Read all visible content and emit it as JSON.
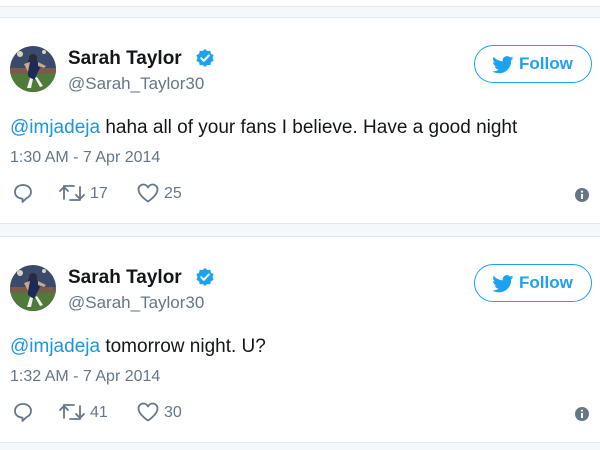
{
  "colors": {
    "accent": "#1da1f2",
    "mention": "#1b95e0",
    "text": "#14171a",
    "muted": "#657786",
    "verified": "#1da1f2"
  },
  "tweets": [
    {
      "user": {
        "name": "Sarah Taylor",
        "handle": "@Sarah_Taylor30",
        "verified": true,
        "avatar_icon": "avatar-photo"
      },
      "follow_label": "Follow",
      "mention": "@imjadeja",
      "text": " haha all of your fans I believe. Have a good night",
      "timestamp": "1:30 AM - 7 Apr 2014",
      "actions": {
        "reply_icon": "reply-icon",
        "retweet_icon": "retweet-icon",
        "retweets": "17",
        "like_icon": "heart-icon",
        "likes": "25",
        "info_icon": "info-icon"
      }
    },
    {
      "user": {
        "name": "Sarah Taylor",
        "handle": "@Sarah_Taylor30",
        "verified": true,
        "avatar_icon": "avatar-photo"
      },
      "follow_label": "Follow",
      "mention": "@imjadeja",
      "text": " tomorrow night. U?",
      "timestamp": "1:32 AM - 7 Apr 2014",
      "actions": {
        "reply_icon": "reply-icon",
        "retweet_icon": "retweet-icon",
        "retweets": "41",
        "like_icon": "heart-icon",
        "likes": "30",
        "info_icon": "info-icon"
      }
    }
  ]
}
